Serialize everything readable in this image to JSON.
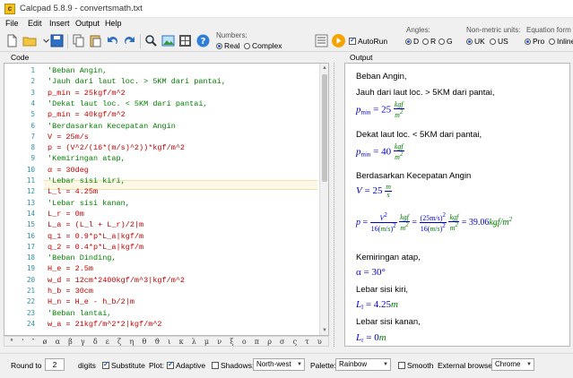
{
  "window": {
    "title": "Calcpad 5.8.9 - convertsmath.txt"
  },
  "menu": [
    "File",
    "Edit",
    "Insert",
    "Output",
    "Help"
  ],
  "toolbar": {
    "numbers_label": "Numbers:",
    "real_label": "Real",
    "complex_label": "Complex",
    "autorun_label": "AutoRun",
    "angles_label": "Angles:",
    "angle_d": "D",
    "angle_r": "R",
    "angle_g": "G",
    "units_label": "Non-metric units:",
    "units_uk": "UK",
    "units_us": "US",
    "eqform_label": "Equation form",
    "eq_pro": "Pro",
    "eq_inline": "Inline"
  },
  "code_panel": {
    "title": "Code",
    "lines": [
      {
        "n": "1",
        "t": "'Beban Angin,",
        "k": "comment"
      },
      {
        "n": "2",
        "t": "'Jauh dari laut loc. > 5KM dari pantai,",
        "k": "comment"
      },
      {
        "n": "3",
        "t": "p_min = 25kgf/m^2",
        "k": "expr"
      },
      {
        "n": "4",
        "t": "'Dekat laut loc. < 5KM dari pantai,",
        "k": "comment"
      },
      {
        "n": "5",
        "t": "p_min = 40kgf/m^2",
        "k": "expr"
      },
      {
        "n": "6",
        "t": "'Berdasarkan Kecepatan Angin",
        "k": "comment"
      },
      {
        "n": "7",
        "t": "V = 25m/s",
        "k": "expr"
      },
      {
        "n": "8",
        "t": "p = (V^2/(16*(m/s)^2))*kgf/m^2",
        "k": "expr"
      },
      {
        "n": "9",
        "t": "'Kemiringan atap,",
        "k": "comment"
      },
      {
        "n": "10",
        "t": " α = 30deg",
        "k": "expr"
      },
      {
        "n": "11",
        "t": "'Lebar sisi kiri,",
        "k": "comment"
      },
      {
        "n": "12",
        "t": "L_l = 4.25m",
        "k": "expr"
      },
      {
        "n": "13",
        "t": "'Lebar sisi kanan,",
        "k": "comment"
      },
      {
        "n": "14",
        "t": "L_r = 0m",
        "k": "expr"
      },
      {
        "n": "15",
        "t": "L_a = (L_l + L_r)/2|m",
        "k": "expr"
      },
      {
        "n": "16",
        "t": "q_1 = 0.9*p*L_a|kgf/m",
        "k": "expr"
      },
      {
        "n": "17",
        "t": "q_2 = 0.4*p*L_a|kgf/m",
        "k": "expr"
      },
      {
        "n": "18",
        "t": "'Beban Dinding,",
        "k": "comment"
      },
      {
        "n": "19",
        "t": "H_e = 2.5m",
        "k": "expr"
      },
      {
        "n": "20",
        "t": "w_d = 12cm*2400kgf/m^3|kgf/m^2",
        "k": "expr"
      },
      {
        "n": "21",
        "t": "h_b = 30cm",
        "k": "expr"
      },
      {
        "n": "22",
        "t": "H_n = H_e - h_b/2|m",
        "k": "expr"
      },
      {
        "n": "23",
        "t": "'Beban lantai,",
        "k": "comment"
      },
      {
        "n": "24",
        "t": "w_a = 21kgf/m^2*2|kgf/m^2",
        "k": "expr"
      }
    ],
    "greek": "° ' ″ ø α β γ δ ε ζ η θ ϑ ι κ λ μ ν ξ ο π ρ σ ς τ υ φ χ ψ ω aA"
  },
  "output_panel": {
    "title": "Output",
    "t1": "Beban Angin,",
    "t2": "Jauh dari laut loc. > 5KM dari pantai,",
    "pmin1_lhs": "p",
    "pmin_sub": "min",
    "pmin1_val": "25",
    "unit_kgf": "kgf",
    "unit_m2": "m",
    "t3": "Dekat laut loc. < 5KM dari pantai,",
    "pmin2_val": "40",
    "t4": "Berdasarkan Kecepatan Angin",
    "v_lhs": "V",
    "v_val": "25",
    "unit_m": "m",
    "unit_s": "s",
    "p_lhs": "p",
    "p_num1": "V",
    "p_den1": "16",
    "p_num2": "(25m/s)",
    "p_den2": "16",
    "p_result": "39.06",
    "p_result_unit": "kgf/m",
    "t5": "Kemiringan atap,",
    "alpha_expr": "α = 30°",
    "t6": "Lebar sisi kiri,",
    "ll_lhs": "L",
    "ll_sub": "l",
    "ll_val": "4.25",
    "t7": "Lebar sisi kanan,",
    "lr_lhs": "L",
    "lr_sub": "r",
    "lr_val": "0"
  },
  "statusbar": {
    "round_label": "Round to",
    "round_value": "2",
    "digits_label": "digits",
    "substitute_label": "Substitute",
    "plot_label": "Plot:",
    "adaptive_label": "Adaptive",
    "shadows_label": "Shadows:",
    "shadows_value": "North-west",
    "palette_label": "Palette:",
    "palette_value": "Rainbow",
    "smooth_label": "Smooth",
    "browser_label": "External browser:",
    "browser_value": "Chrome"
  },
  "colors": {
    "comment": "#008000",
    "expr": "#c00000",
    "line_number": "#2b91af",
    "math_var": "#0000cc",
    "math_unit": "#008000"
  }
}
